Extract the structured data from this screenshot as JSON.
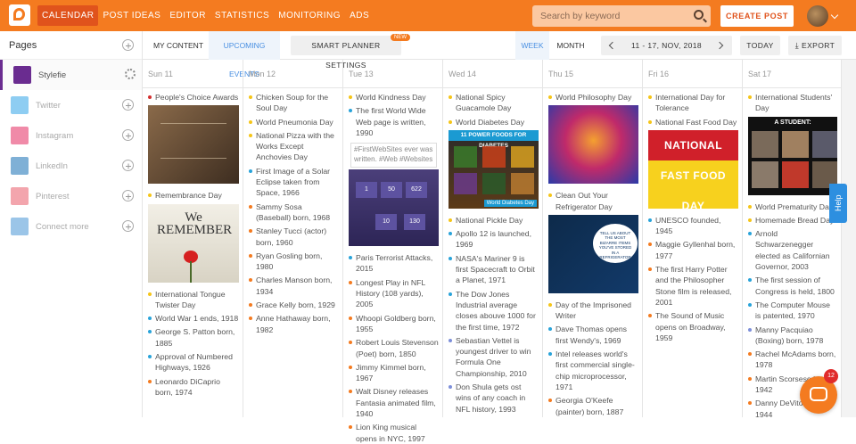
{
  "nav": {
    "items": [
      {
        "label": "CALENDAR",
        "active": true
      },
      {
        "label": "POST IDEAS"
      },
      {
        "label": "EDITOR"
      },
      {
        "label": "STATISTICS"
      },
      {
        "label": "MONITORING"
      },
      {
        "label": "ADS"
      }
    ],
    "search_placeholder": "Search by keyword",
    "create_post": "CREATE POST"
  },
  "sidebar": {
    "title": "Pages",
    "items": [
      {
        "label": "Stylefie",
        "active": true,
        "icon": "stylefie-icon",
        "color": "#6a2c90"
      },
      {
        "label": "Twitter",
        "icon": "twitter-icon",
        "color": "#8ecdf2"
      },
      {
        "label": "Instagram",
        "icon": "instagram-icon",
        "color": "#f08aa8"
      },
      {
        "label": "LinkedIn",
        "icon": "linkedin-icon",
        "color": "#7fb0d6"
      },
      {
        "label": "Pinterest",
        "icon": "pinterest-icon",
        "color": "#f3a5ad"
      },
      {
        "label": "Connect more",
        "icon": "connect-icon",
        "color": "#9bc5e8"
      }
    ]
  },
  "toolbar": {
    "my_content": "MY CONTENT",
    "upcoming": "UPCOMING EVENTS",
    "planner": "SMART PLANNER SETTINGS",
    "new": "NEW",
    "week": "WEEK",
    "month": "MONTH",
    "range": "11 - 17, NOV, 2018",
    "today": "TODAY",
    "export": "EXPORT"
  },
  "days": [
    {
      "label": "Sun 11",
      "events": [
        {
          "t": "People's Choice Awards",
          "c": "#d32f2f"
        },
        {
          "img": "quote",
          "h": 88
        },
        {
          "t": "Remembrance Day",
          "c": "#f5c518"
        },
        {
          "img": "remember",
          "h": 88
        },
        {
          "t": "International Tongue Twister Day",
          "c": "#f5c518"
        },
        {
          "t": "World War 1 ends, 1918",
          "c": "#29a3d9"
        },
        {
          "t": "George S. Patton born, 1885",
          "c": "#29a3d9"
        },
        {
          "t": "Approval of Numbered Highways, 1926",
          "c": "#29a3d9"
        },
        {
          "t": "Leonardo DiCaprio born, 1974",
          "c": "#f47b20"
        }
      ]
    },
    {
      "label": "Mon 12",
      "events": [
        {
          "t": "Chicken Soup for the Soul Day",
          "c": "#f5c518"
        },
        {
          "t": "World Pneumonia Day",
          "c": "#f5c518"
        },
        {
          "t": "National Pizza with the Works Except Anchovies Day",
          "c": "#f5c518"
        },
        {
          "t": "First Image of a Solar Eclipse taken from Space, 1966",
          "c": "#29a3d9"
        },
        {
          "t": "Sammy Sosa (Baseball) born, 1968",
          "c": "#f47b20"
        },
        {
          "t": "Stanley Tucci (actor) born, 1960",
          "c": "#f47b20"
        },
        {
          "t": "Ryan Gosling born, 1980",
          "c": "#f47b20"
        },
        {
          "t": "Charles Manson born, 1934",
          "c": "#f47b20"
        },
        {
          "t": "Grace Kelly born, 1929",
          "c": "#f47b20"
        },
        {
          "t": "Anne Hathaway born, 1982",
          "c": "#f47b20"
        }
      ]
    },
    {
      "label": "Tue 13",
      "events": [
        {
          "t": "World Kindness Day",
          "c": "#f5c518"
        },
        {
          "t": "The first World Wide Web page is written, 1990",
          "c": "#29a3d9"
        },
        {
          "img": "web",
          "h": 118
        },
        {
          "t": "Paris Terrorist Attacks, 2015",
          "c": "#29a3d9"
        },
        {
          "t": "Longest Play in NFL History (108 yards), 2005",
          "c": "#f47b20"
        },
        {
          "t": "Whoopi Goldberg born, 1955",
          "c": "#f47b20"
        },
        {
          "t": "Robert Louis Stevenson (Poet) born, 1850",
          "c": "#f47b20"
        },
        {
          "t": "Jimmy Kimmel born, 1967",
          "c": "#f47b20"
        },
        {
          "t": "Walt Disney releases Fantasia animated film, 1940",
          "c": "#f47b20"
        },
        {
          "t": "Lion King musical opens in NYC, 1997",
          "c": "#f47b20"
        }
      ]
    },
    {
      "label": "Wed 14",
      "events": [
        {
          "t": "National Spicy Guacamole Day",
          "c": "#f5c518"
        },
        {
          "t": "World Diabetes Day",
          "c": "#f5c518"
        },
        {
          "img": "foods",
          "h": 88
        },
        {
          "t": "National Pickle Day",
          "c": "#f5c518"
        },
        {
          "t": "Apollo 12 is launched, 1969",
          "c": "#29a3d9"
        },
        {
          "t": "NASA's Mariner 9 is first Spacecraft to Orbit a Planet, 1971",
          "c": "#29a3d9"
        },
        {
          "t": "The Dow Jones Industrial average closes abouve 1000 for the first time, 1972",
          "c": "#29a3d9"
        },
        {
          "t": "Sebastian Vettel is youngest driver to win Formula One Championship, 2010",
          "c": "#7d8fd9"
        },
        {
          "t": "Don Shula gets ost wins of any coach in NFL history, 1993",
          "c": "#7d8fd9"
        }
      ]
    },
    {
      "label": "Thu 15",
      "events": [
        {
          "t": "World Philosophy Day",
          "c": "#f5c518"
        },
        {
          "img": "philo",
          "h": 88
        },
        {
          "t": "Clean Out Your Refrigerator Day",
          "c": "#f5c518"
        },
        {
          "img": "fridge",
          "h": 88
        },
        {
          "t": "Day of the Imprisoned Writer",
          "c": "#f5c518"
        },
        {
          "t": "Dave Thomas opens first Wendy's, 1969",
          "c": "#29a3d9"
        },
        {
          "t": "Intel releases world's first commercial single-chip microprocessor, 1971",
          "c": "#29a3d9"
        },
        {
          "t": "Georgia O'Keefe (painter) born, 1887",
          "c": "#f47b20"
        }
      ]
    },
    {
      "label": "Fri 16",
      "events": [
        {
          "t": "International Day for Tolerance",
          "c": "#f5c518"
        },
        {
          "t": "National Fast Food Day",
          "c": "#f5c518"
        },
        {
          "img": "fastfood",
          "h": 88
        },
        {
          "t": "UNESCO founded, 1945",
          "c": "#29a3d9"
        },
        {
          "t": "Maggie Gyllenhal born, 1977",
          "c": "#f47b20"
        },
        {
          "t": "The first Harry Potter and the Philosopher Stone film is released, 2001",
          "c": "#f47b20"
        },
        {
          "t": "The Sound of Music opens on Broadway, 1959",
          "c": "#f47b20"
        }
      ]
    },
    {
      "label": "Sat 17",
      "events": [
        {
          "t": "International Students' Day",
          "c": "#f5c518"
        },
        {
          "img": "student",
          "h": 88
        },
        {
          "t": "World Prematurity Day",
          "c": "#f5c518"
        },
        {
          "t": "Homemade Bread Day",
          "c": "#f5c518"
        },
        {
          "t": "Arnold Schwarzenegger elected as Californian Governor, 2003",
          "c": "#29a3d9"
        },
        {
          "t": "The first session of Congress is held, 1800",
          "c": "#29a3d9"
        },
        {
          "t": "The Computer Mouse is patented, 1970",
          "c": "#29a3d9"
        },
        {
          "t": "Manny Pacquiao (Boxing) born, 1978",
          "c": "#7d8fd9"
        },
        {
          "t": "Rachel McAdams born, 1978",
          "c": "#f47b20"
        },
        {
          "t": "Martin Scorsese born, 1942",
          "c": "#f47b20"
        },
        {
          "t": "Danny DeVito born, 1944",
          "c": "#f47b20"
        }
      ]
    }
  ],
  "help": "Help",
  "chat_count": "12",
  "image_text": {
    "remember_title": "We REMEMBER",
    "web_caption": "#FirstWebSites ever was written. #Web #Websites",
    "web_numbers": [
      "1",
      "50",
      "622",
      "10",
      "130"
    ],
    "foods_title": "11 POWER FOODS FOR DIABETES",
    "foods_sub": "World Diabetes Day",
    "fastfood_title": "NATIONAL FAST FOOD DAY",
    "student_title": "A STUDENT:",
    "fridge_text": "TELL US ABOUT THE MOST BIZARRE ITEMS YOU'VE STORED IN A REFRIGERATOR"
  }
}
